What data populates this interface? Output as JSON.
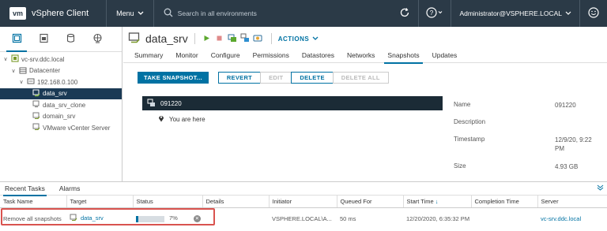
{
  "header": {
    "logo": "vm",
    "app_title": "vSphere Client",
    "menu_label": "Menu",
    "search_placeholder": "Search in all environments",
    "user": "Administrator@VSPHERE.LOCAL"
  },
  "tree": {
    "root": "vc-srv.ddc.local",
    "datacenter": "Datacenter",
    "host": "192.168.0.100",
    "vms": [
      "data_srv",
      "data_srv_clone",
      "domain_srv",
      "VMware vCenter Server"
    ]
  },
  "object": {
    "name": "data_srv",
    "actions_label": "ACTIONS"
  },
  "tabs": [
    "Summary",
    "Monitor",
    "Configure",
    "Permissions",
    "Datastores",
    "Networks",
    "Snapshots",
    "Updates"
  ],
  "buttons": {
    "take_snapshot": "TAKE SNAPSHOT...",
    "revert": "REVERT",
    "edit": "EDIT",
    "delete": "DELETE",
    "delete_all": "DELETE ALL"
  },
  "snapshot": {
    "name": "091220",
    "you_are_here": "You are here"
  },
  "details": {
    "name_label": "Name",
    "name_value": "091220",
    "description_label": "Description",
    "timestamp_label": "Timestamp",
    "timestamp_value": "12/9/20, 9:22 PM",
    "size_label": "Size",
    "size_value": "4.93 GB"
  },
  "tasks": {
    "tabs": [
      "Recent Tasks",
      "Alarms"
    ],
    "columns": [
      "Task Name",
      "Target",
      "Status",
      "Details",
      "Initiator",
      "Queued For",
      "Start Time",
      "Completion Time",
      "Server"
    ],
    "row": {
      "task_name": "Remove all snapshots",
      "target": "data_srv",
      "progress_percent": 7,
      "status_text": "7%",
      "details": "",
      "initiator": "VSPHERE.LOCAL\\A...",
      "queued_for": "50 ms",
      "start_time": "12/20/2020, 6:35:32 PM",
      "completion_time": "",
      "server": "vc-srv.ddc.local"
    }
  },
  "colors": {
    "header_bg": "#2b3a47",
    "accent": "#0072a3",
    "selected_bg": "#1b3a55",
    "highlight_border": "#d9534f"
  }
}
